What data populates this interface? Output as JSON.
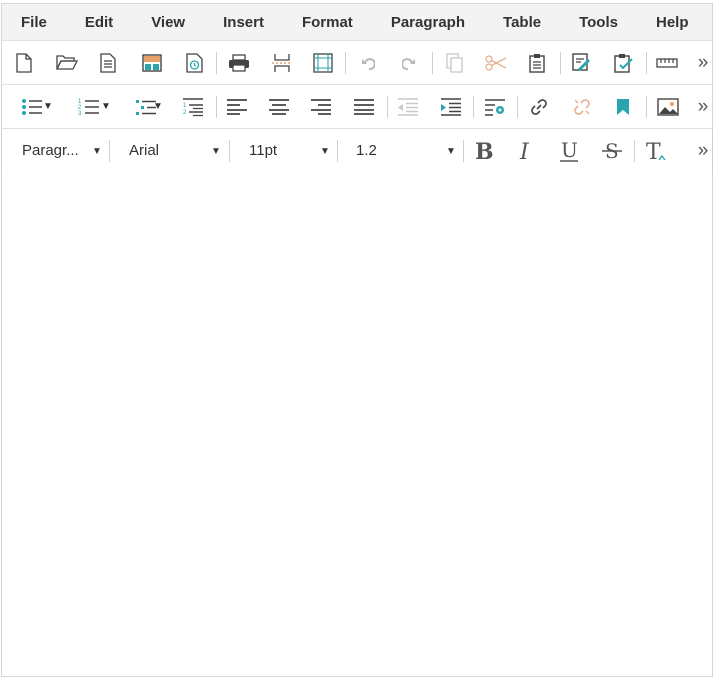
{
  "menu": [
    "File",
    "Edit",
    "View",
    "Insert",
    "Format",
    "Paragraph",
    "Table",
    "Tools",
    "Help"
  ],
  "toolbar": {
    "more_label": "»",
    "block_format": "Paragr...",
    "font_family": "Arial",
    "font_size": "11pt",
    "line_height": "1.2",
    "caret": "▼"
  },
  "colors": {
    "teal": "#2aa5b0",
    "dark": "#444444",
    "orange": "#e8a068",
    "faded": "#c8c8c8"
  }
}
